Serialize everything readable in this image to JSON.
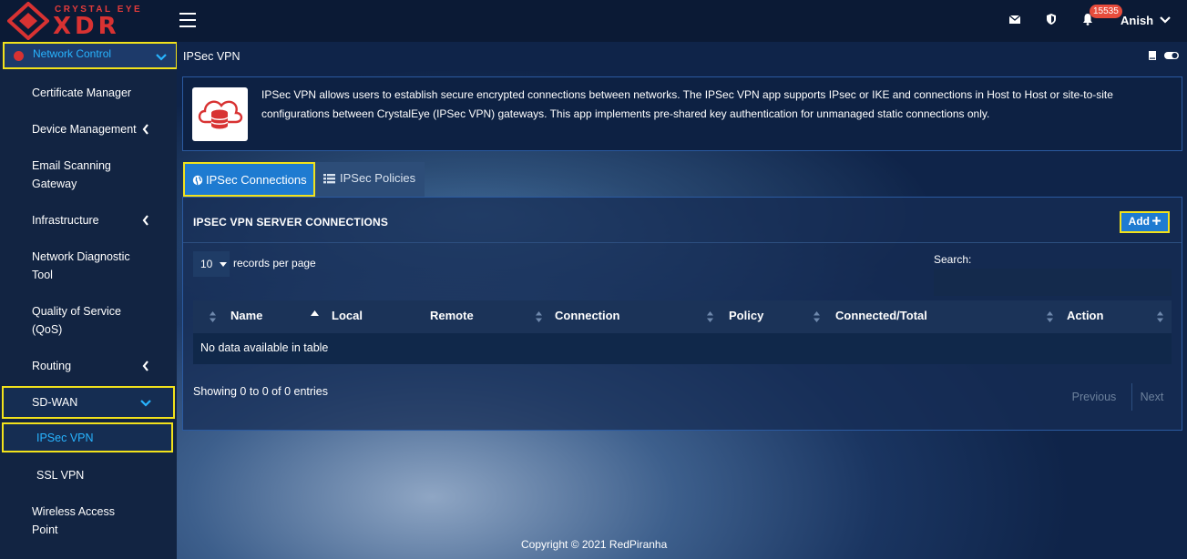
{
  "brand": {
    "top": "CRYSTAL EYE",
    "main": "XDR",
    "color": "#d83232"
  },
  "topbar": {
    "icons": [
      "mail-icon",
      "shield-icon",
      "bell-icon"
    ],
    "notification_count": "15535",
    "user": "Anish"
  },
  "sidebar": {
    "section": {
      "label": "Network Control",
      "accent": "#28b4ff"
    },
    "items": [
      {
        "label": "Certificate Manager",
        "chevron": ""
      },
      {
        "label": "Device Management",
        "chevron": "‹"
      },
      {
        "label": "Email Scanning",
        "label2": "Gateway",
        "chevron": ""
      },
      {
        "label": "Infrastructure",
        "chevron": "‹"
      },
      {
        "label": "Network Diagnostic",
        "label2": "Tool",
        "chevron": ""
      },
      {
        "label": "Quality of Service",
        "label2": "(QoS)",
        "chevron": ""
      },
      {
        "label": "Routing",
        "chevron": "‹"
      },
      {
        "label": "SD-WAN",
        "chevron": "⌄"
      },
      {
        "label": "IPSec VPN",
        "chevron": ""
      },
      {
        "label": "SSL VPN",
        "chevron": ""
      },
      {
        "label": "Wireless Access",
        "label2": "Point",
        "chevron": ""
      }
    ]
  },
  "page": {
    "title": "IPSec VPN",
    "description": "IPSec VPN allows users to establish secure encrypted connections between networks. The IPSec VPN app supports IPsec or IKE and connections in Host to Host or site-to-site configurations between CrystalEye (IPSec VPN) gateways. This app implements pre-shared key authentication for unmanaged static connections only.",
    "tabs": [
      {
        "label": "IPSec Connections",
        "icon": "globe-icon",
        "active": true
      },
      {
        "label": "IPSec Policies",
        "icon": "list-icon",
        "active": false
      }
    ]
  },
  "panel": {
    "title": "IPSEC VPN SERVER CONNECTIONS",
    "add_label": "Add",
    "records_value": "10",
    "records_text": "records per page",
    "search_label": "Search:",
    "search_value": "",
    "columns": [
      "Name",
      "Local",
      "Remote",
      "Connection",
      "Policy",
      "Connected/Total",
      "Action"
    ],
    "empty_text": "No data available in table",
    "info": "Showing 0 to 0 of 0 entries",
    "prev_label": "Previous",
    "next_label": "Next"
  },
  "footer": "Copyright © 2021 RedPiranha"
}
